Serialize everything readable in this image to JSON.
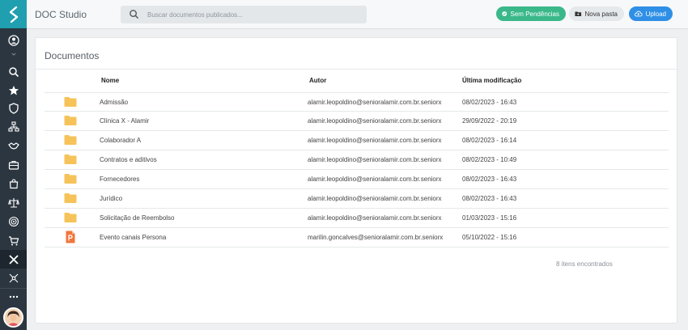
{
  "app": {
    "title": "DOC Studio"
  },
  "search": {
    "placeholder": "Buscar documentos publicados..."
  },
  "toolbar": {
    "pending_label": "Sem Pendências",
    "new_folder_label": "Nova pasta",
    "upload_label": "Upload"
  },
  "colors": {
    "rail": "#2b3640",
    "accent": "#1f9fb0",
    "success": "#3ab88a",
    "primary": "#2f8fe6",
    "folder": "#f6c35a",
    "ppt": "#f0763b"
  },
  "rail_icons": [
    "logo-icon",
    "user-icon",
    "chevron-icon",
    "search-icon",
    "star-icon",
    "shield-icon",
    "org-icon",
    "handshake-icon",
    "briefcase-icon",
    "bag-icon",
    "scale-icon",
    "target-icon",
    "cart-icon",
    "x-icon",
    "network-icon",
    "more-icon",
    "avatar"
  ],
  "documents": {
    "title": "Documentos",
    "columns": {
      "name": "Nome",
      "author": "Autor",
      "modified": "Última modificação"
    },
    "rows": [
      {
        "type": "folder-icon",
        "name": "Admissão",
        "author": "alamir.leopoldino@senioralamir.com.br.seniorx",
        "modified": "08/02/2023 - 16:43"
      },
      {
        "type": "folder-icon",
        "name": "Clínica X - Alamir",
        "author": "alamir.leopoldino@senioralamir.com.br.seniorx",
        "modified": "29/09/2022 - 20:19"
      },
      {
        "type": "folder-icon",
        "name": "Colaborador A",
        "author": "alamir.leopoldino@senioralamir.com.br.seniorx",
        "modified": "08/02/2023 - 16:14"
      },
      {
        "type": "folder-icon",
        "name": "Contratos e aditivos",
        "author": "alamir.leopoldino@senioralamir.com.br.seniorx",
        "modified": "08/02/2023 - 10:49"
      },
      {
        "type": "folder-icon",
        "name": "Fornecedores",
        "author": "alamir.leopoldino@senioralamir.com.br.seniorx",
        "modified": "08/02/2023 - 16:43"
      },
      {
        "type": "folder-icon",
        "name": "Jurídico",
        "author": "alamir.leopoldino@senioralamir.com.br.seniorx",
        "modified": "08/02/2023 - 16:43"
      },
      {
        "type": "folder-icon",
        "name": "Solicitação de Reembolso",
        "author": "alamir.leopoldino@senioralamir.com.br.seniorx",
        "modified": "01/03/2023 - 15:16"
      },
      {
        "type": "powerpoint-icon",
        "name": "Evento canais Persona",
        "author": "marilin.goncalves@senioralamir.com.br.seniorx",
        "modified": "05/10/2022 - 15:16"
      }
    ],
    "count_label": "8 itens encontrados"
  }
}
